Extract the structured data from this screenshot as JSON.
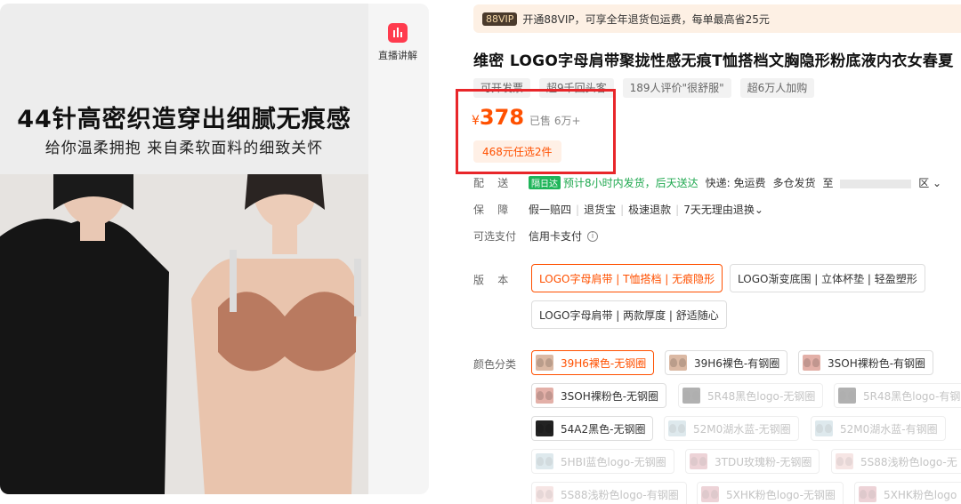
{
  "media": {
    "headline": "44针高密织造穿出细腻无痕感",
    "subline": "给你温柔拥抱 来自柔软面料的细致关怀",
    "live_label": "直播讲解"
  },
  "vip": {
    "tag": "88VIP",
    "text": "开通88VIP，可享全年退货包运费，每单最高省25元"
  },
  "product": {
    "title": "维密 LOGO字母肩带聚拢性感无痕T恤搭档文胸隐形粉底液内衣女春夏",
    "tags": [
      "可开发票",
      "超9千回头客",
      "189人评价\"很舒服\"",
      "超6万人加购"
    ]
  },
  "price": {
    "symbol": "¥",
    "value": "378",
    "sold": "已售 6万+",
    "promo": "468元任选2件"
  },
  "shipping": {
    "label": "配    送",
    "badge": "隔日达",
    "eta": "预计8小时内发货，后天送达",
    "fee": "快递: 免运费",
    "multi": "多仓发货",
    "dest": "至",
    "dest_tail": "区"
  },
  "guarantee": {
    "label": "保    障",
    "items": [
      "假一赔四",
      "退货宝",
      "极速退款",
      "7天无理由退换"
    ]
  },
  "payment": {
    "label": "可选支付",
    "method": "信用卡支付",
    "info_icon": "info-icon"
  },
  "version": {
    "label": "版    本",
    "options": [
      "LOGO字母肩带 | T恤搭档 | 无痕隐形",
      "LOGO渐变底围 | 立体杯垫 | 轻盈塑形",
      "LOGO字母肩带 | 两款厚度 | 舒适随心"
    ],
    "selected": 0
  },
  "colors": {
    "label": "颜色分类",
    "items": [
      {
        "name": "39H6裸色-无钢圈",
        "swatch": "nude",
        "state": "selected"
      },
      {
        "name": "39H6裸色-有钢圈",
        "swatch": "nude",
        "state": "normal"
      },
      {
        "name": "3SOH裸粉色-有钢圈",
        "swatch": "pink",
        "state": "normal"
      },
      {
        "name": "3SOH裸粉色-无钢圈",
        "swatch": "pink",
        "state": "normal"
      },
      {
        "name": "5R48黑色logo-无钢圈",
        "swatch": "black",
        "state": "disabled"
      },
      {
        "name": "5R48黑色logo-有钢",
        "swatch": "black",
        "state": "disabled"
      },
      {
        "name": "54A2黑色-无钢圈",
        "swatch": "black",
        "state": "normal"
      },
      {
        "name": "52M0湖水蓝-无钢圈",
        "swatch": "blue",
        "state": "disabled"
      },
      {
        "name": "52M0湖水蓝-有钢圈",
        "swatch": "blue",
        "state": "disabled"
      },
      {
        "name": "5HBI蓝色logo-无钢圈",
        "swatch": "blue",
        "state": "disabled"
      },
      {
        "name": "3TDU玫瑰粉-无钢圈",
        "swatch": "rose",
        "state": "disabled"
      },
      {
        "name": "5S88浅粉色logo-无",
        "swatch": "lpink",
        "state": "disabled"
      },
      {
        "name": "5S88浅粉色logo-有钢圈",
        "swatch": "lpink",
        "state": "disabled"
      },
      {
        "name": "5XHK粉色logo-无钢圈",
        "swatch": "rose",
        "state": "disabled"
      },
      {
        "name": "5XHK粉色logo",
        "swatch": "rose",
        "state": "disabled"
      }
    ]
  },
  "theme": {
    "accent": "#ff5000",
    "highlight_box": "#e8262a",
    "badge_green": "#1fb55a"
  }
}
